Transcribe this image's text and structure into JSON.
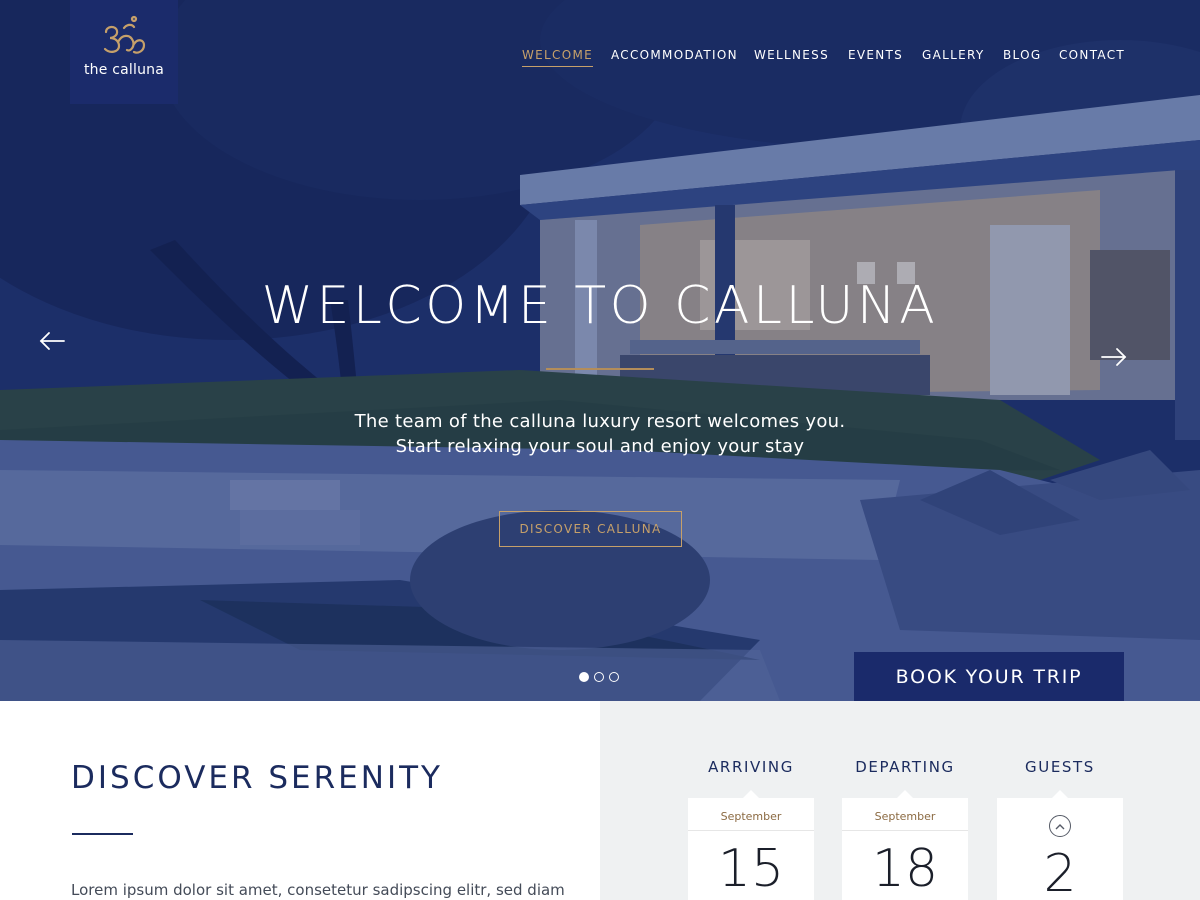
{
  "brand": {
    "name": "the calluna",
    "accent": "#c6a06a",
    "navy": "#1a2a6b"
  },
  "nav": {
    "items": [
      {
        "label": "WELCOME",
        "active": true
      },
      {
        "label": "ACCOMMODATION",
        "active": false
      },
      {
        "label": "WELLNESS",
        "active": false
      },
      {
        "label": "EVENTS",
        "active": false
      },
      {
        "label": "GALLERY",
        "active": false
      },
      {
        "label": "BLOG",
        "active": false
      },
      {
        "label": "CONTACT",
        "active": false
      }
    ]
  },
  "hero": {
    "title": "WELCOME TO CALLUNA",
    "subtitle_line1": "The team of the calluna luxury resort welcomes you.",
    "subtitle_line2": "Start relaxing your soul and enjoy your stay",
    "cta_label": "DISCOVER CALLUNA",
    "prev_icon": "arrow-left-icon",
    "next_icon": "arrow-right-icon",
    "slides_count": 3,
    "active_slide": 1,
    "book_label": "BOOK YOUR TRIP"
  },
  "discover": {
    "title": "DISCOVER SERENITY",
    "body": "Lorem ipsum dolor sit amet, consetetur sadipscing elitr, sed diam"
  },
  "booking": {
    "arriving": {
      "label": "ARRIVING",
      "month": "September",
      "day": "15"
    },
    "departing": {
      "label": "DEPARTING",
      "month": "September",
      "day": "18"
    },
    "guests": {
      "label": "GUESTS",
      "count": "2",
      "increment_icon": "chevron-up-icon"
    }
  }
}
